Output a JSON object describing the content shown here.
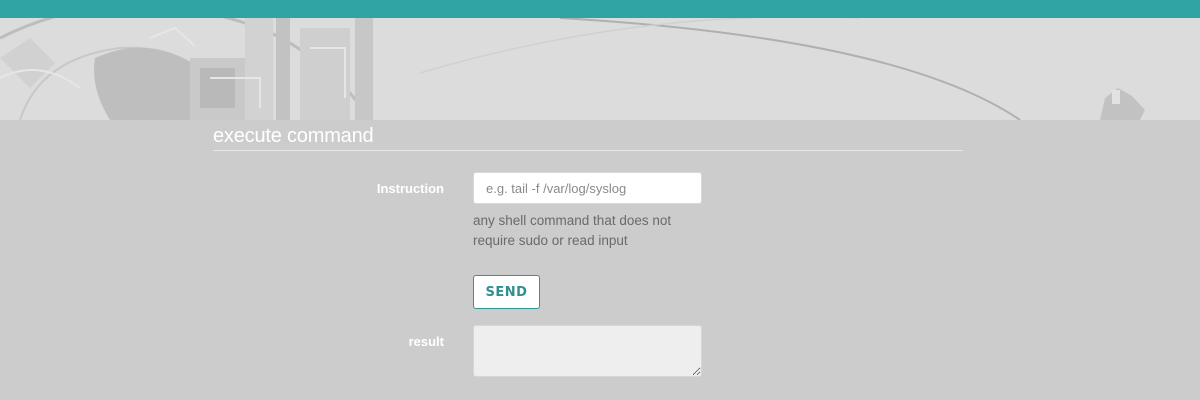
{
  "colors": {
    "accent": "#2fa4a4",
    "content_background": "#cccccc",
    "hero_background": "#dcdcdc"
  },
  "hero": {
    "image": "decorative-gear-illustration"
  },
  "form": {
    "title": "execute command",
    "instruction": {
      "label": "Instruction",
      "placeholder": "e.g. tail -f /var/log/syslog",
      "value": "",
      "help": "any shell command that does not require sudo or read input"
    },
    "send_label": "SEND",
    "result": {
      "label": "result",
      "value": ""
    }
  }
}
